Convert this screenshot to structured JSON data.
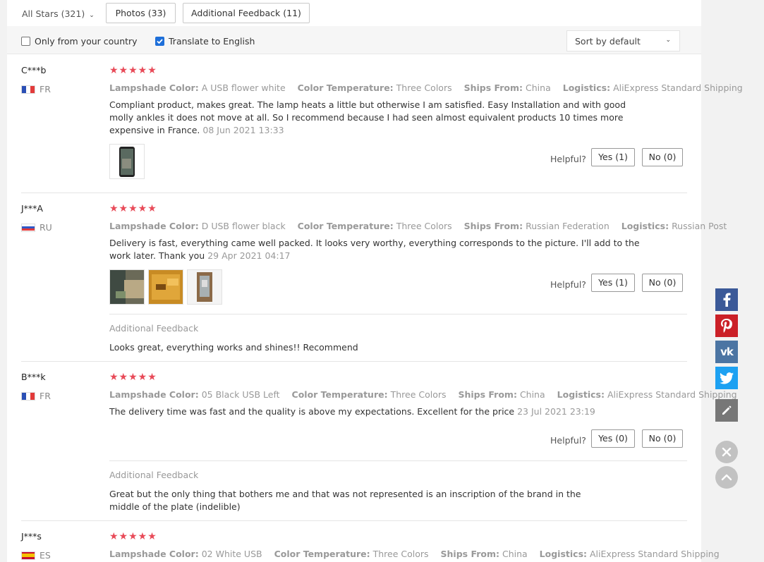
{
  "toolbar": {
    "stars_filter": "All Stars (321)",
    "photos_tab": "Photos (33)",
    "additional_tab": "Additional Feedback (11)"
  },
  "filters": {
    "only_country": "Only from your country",
    "only_country_checked": false,
    "translate": "Translate to English",
    "translate_checked": true,
    "sort": "Sort by default"
  },
  "labels": {
    "lampshade": "Lampshade Color:",
    "temperature": "Color Temperature:",
    "ships": "Ships From:",
    "logistics": "Logistics:",
    "helpful": "Helpful?",
    "additional_feedback": "Additional Feedback"
  },
  "reviews": [
    {
      "user": "C***b",
      "country": "FR",
      "stars": "★★★★★",
      "lampshade": "A USB flower white",
      "temperature": "Three Colors",
      "ships": "China",
      "logistics": "AliExpress Standard Shipping",
      "text_lines": [
        "Compliant product, makes great. The lamp heats a little but otherwise I am satisfied. Easy Installation and with good",
        "molly ankles it does not move at all. So I recommend because I had seen almost equivalent products 10 times more",
        "expensive in France."
      ],
      "date": "08 Jun 2021 13:33",
      "yes": "Yes (1)",
      "no": "No (0)"
    },
    {
      "user": "J***A",
      "country": "RU",
      "stars": "★★★★★",
      "lampshade": "D USB flower black",
      "temperature": "Three Colors",
      "ships": "Russian Federation",
      "logistics": "Russian Post",
      "text_lines": [
        "Delivery is fast, everything came well packed. It looks very worthy, everything corresponds to the picture. I'll add to the",
        "work later. Thank you"
      ],
      "date": "29 Apr 2021 04:17",
      "yes": "Yes (1)",
      "no": "No (0)",
      "additional": "Looks great, everything works and shines!! Recommend"
    },
    {
      "user": "B***k",
      "country": "FR",
      "stars": "★★★★★",
      "lampshade": "05 Black USB Left",
      "temperature": "Three Colors",
      "ships": "China",
      "logistics": "AliExpress Standard Shipping",
      "text_lines": [
        "The delivery time was fast and the quality is above my expectations. Excellent for the price"
      ],
      "date": "23 Jul 2021 23:19",
      "yes": "Yes (0)",
      "no": "No (0)",
      "additional_lines": [
        "Great but the only thing that bothers me and that was not represented is an inscription of the brand in the",
        "middle of the plate (indelible)"
      ]
    },
    {
      "user": "J***s",
      "country": "ES",
      "stars": "★★★★★",
      "lampshade": "02 White USB",
      "temperature": "Three Colors",
      "ships": "China",
      "logistics": "AliExpress Standard Shipping"
    }
  ],
  "social": {
    "facebook": "facebook-icon",
    "pinterest": "pinterest-icon",
    "vk": "vk-icon",
    "twitter": "twitter-icon",
    "edit": "pencil-icon",
    "close": "close-icon",
    "top": "chevron-up-icon"
  },
  "colors": {
    "star": "#e84a58",
    "facebook": "#3b5998",
    "pinterest": "#cb2027",
    "vk": "#4c75a3",
    "twitter": "#1da1f2",
    "edit": "#777777"
  }
}
